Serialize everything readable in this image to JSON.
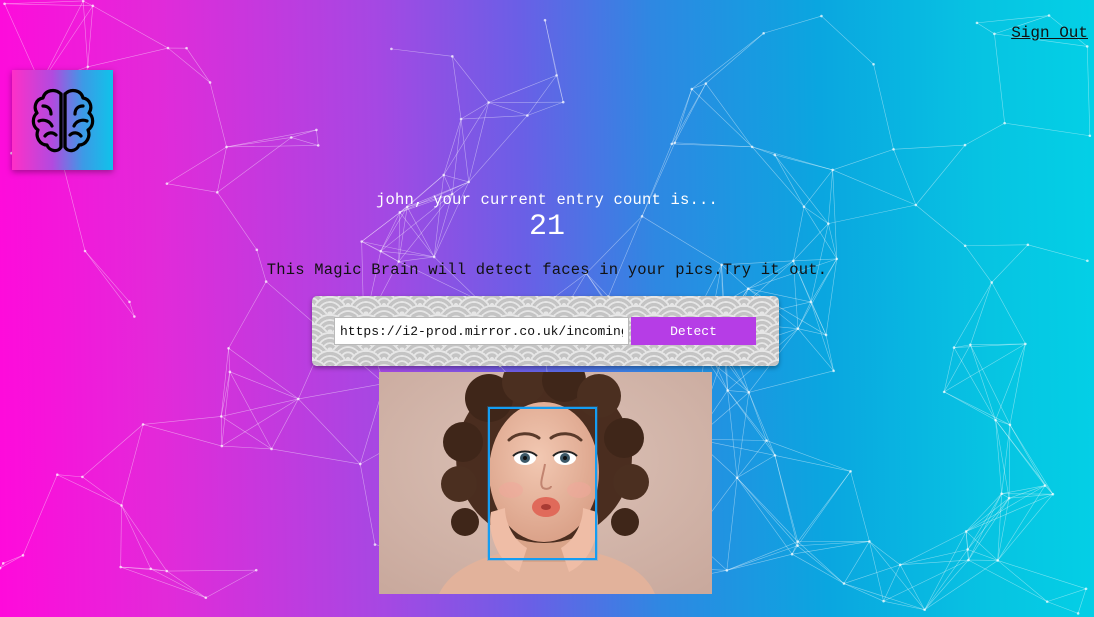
{
  "nav": {
    "sign_out_label": "Sign Out"
  },
  "logo": {
    "icon": "brain-icon"
  },
  "rank": {
    "message": "john, your current entry count is...",
    "count": "21"
  },
  "intro": {
    "text": "This Magic Brain will detect faces in your pics.Try it out."
  },
  "image_form": {
    "url_value": "https://i2-prod.mirror.co.uk/incoming/article",
    "detect_label": "Detect"
  },
  "result": {
    "image": "woman-face-photo",
    "faces_detected": 1
  },
  "colors": {
    "gradient_left": "#ff0adb",
    "gradient_right": "#03d0e6",
    "detect_button": "#b63de6",
    "face_box": "#149df2"
  }
}
